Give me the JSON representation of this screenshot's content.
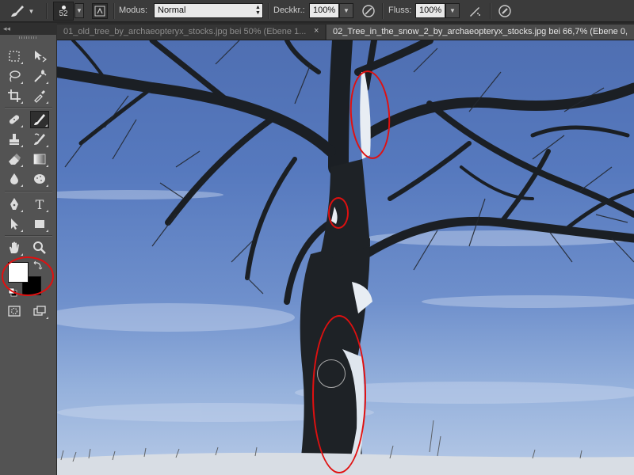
{
  "options_bar": {
    "brush_size": "52",
    "mode_label": "Modus:",
    "mode_value": "Normal",
    "opacity_label": "Deckkr.:",
    "opacity_value": "100%",
    "flow_label": "Fluss:",
    "flow_value": "100%"
  },
  "tabs": [
    {
      "label": "01_old_tree_by_archaeopteryx_stocks.jpg bei 50% (Ebene 1...",
      "close": "×"
    },
    {
      "label": "02_Tree_in_the_snow_2_by_archaeopteryx_stocks.jpg bei 66,7% (Ebene 0,"
    }
  ],
  "toolbox": {
    "collapse_label": "◂◂",
    "active_tool": "brush-tool",
    "foreground_color": "#ffffff",
    "background_color": "#000000"
  },
  "colors": {
    "annotation_red": "#e01010",
    "ui_panel": "#535353",
    "sky_blue": "#5679be"
  }
}
